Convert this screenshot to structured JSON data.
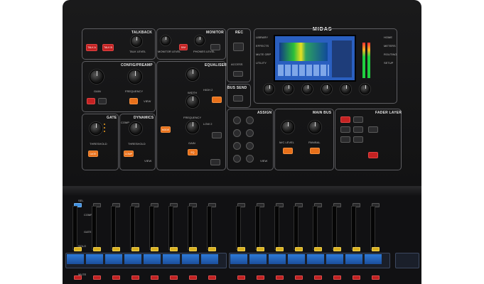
{
  "brand": {
    "logo_text": "MIDAS"
  },
  "talkback": {
    "title": "TALKBACK",
    "talk_level": "TALK LEVEL",
    "btn_a": "TALK A",
    "btn_b": "TALK B",
    "min": "MIN",
    "max": "MAX"
  },
  "monitor": {
    "title": "MONITOR",
    "monitor_level": "MONITOR LEVEL",
    "phones_level": "PHONES LEVEL",
    "dim_btn": "DIM"
  },
  "rec": {
    "title": "REC",
    "access": "ACCESS"
  },
  "bus_send": {
    "title": "BUS SEND"
  },
  "config": {
    "title": "CONFIG/PREAMP",
    "gain": "GAIN",
    "frequency": "FREQUENCY",
    "view": "VIEW"
  },
  "equaliser": {
    "title": "EQUALISER",
    "width": "WIDTH",
    "frequency": "FREQUENCY",
    "gain": "GAIN",
    "high2": "HIGH 2",
    "low2": "LOW 2",
    "mode": "MODE",
    "eq": "EQ"
  },
  "gate": {
    "title": "GATE",
    "threshold": "THRESHOLD",
    "gate_btn": "GATE",
    "view": "VIEW"
  },
  "dynamics": {
    "title": "DYNAMICS",
    "threshold": "THRESHOLD",
    "comp_btn": "COMP",
    "comp": "COMP"
  },
  "assign": {
    "title": "ASSIGN",
    "view": "VIEW"
  },
  "main_bus": {
    "title": "MAIN BUS",
    "mc_level": "M/C LEVEL",
    "pan_bal": "PAN/BAL"
  },
  "fader_layer": {
    "title": "FADER LAYER"
  },
  "screen": {
    "tabs": [
      "HOME",
      "METERS",
      "ROUTING",
      "SETUP",
      "LIBRARY",
      "EFFECTS",
      "MUTE GRP",
      "UTILITY"
    ]
  },
  "channels": {
    "comp": "COMP",
    "gate": "GATE",
    "sel": "SEL",
    "solo": "SOLO",
    "mute": "MUTE",
    "label": "Ch"
  },
  "colors": {
    "accent_orange": "#e8701a",
    "accent_red": "#c42222",
    "screen_blue": "#2a5fc0",
    "meter_green": "#20d040"
  }
}
